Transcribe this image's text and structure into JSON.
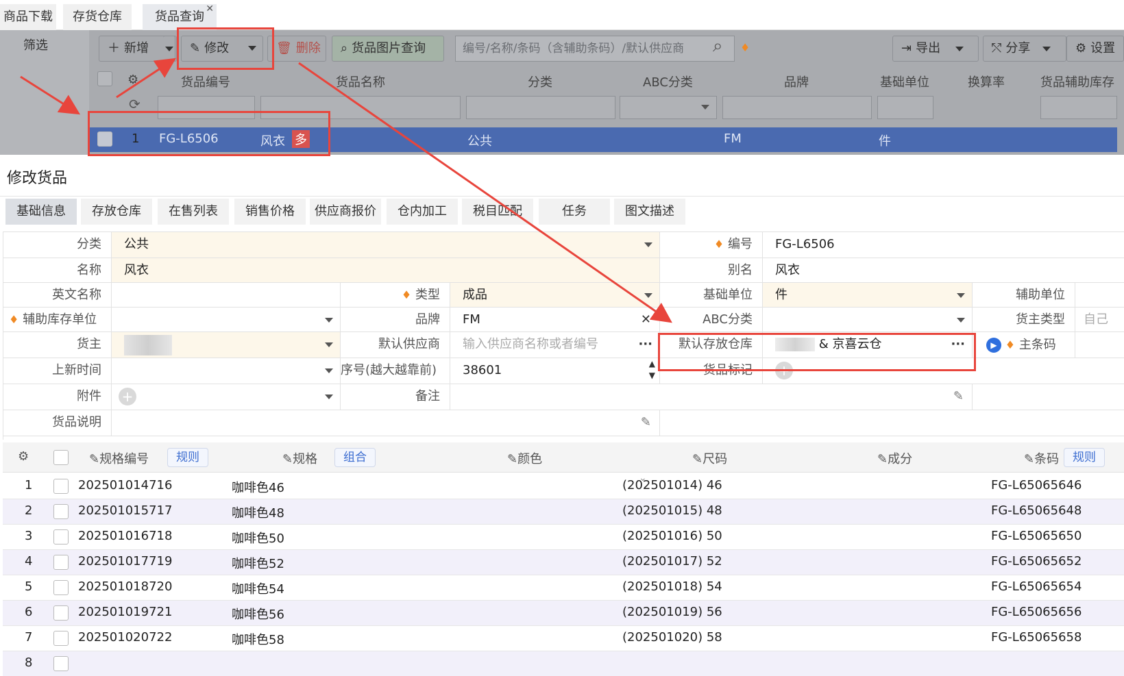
{
  "tabs": [
    {
      "label": "商品下载"
    },
    {
      "label": "存货仓库"
    },
    {
      "label": "货品查询"
    }
  ],
  "sidebar": {
    "filter": "筛选"
  },
  "toolbar": {
    "add": "新增",
    "edit": "修改",
    "delete": "删除",
    "image_query": "货品图片查询",
    "search_placeholder": "编号/名称/条码（含辅助条码）/默认供应商",
    "export": "导出",
    "share": "分享",
    "settings": "设置"
  },
  "grid": {
    "headers": [
      "货品编号",
      "货品名称",
      "分类",
      "ABC分类",
      "品牌",
      "基础单位",
      "换算率",
      "货品辅助库存"
    ],
    "row": {
      "index": "1",
      "code": "FG-L6506",
      "name": "风衣",
      "multi": "多",
      "category": "公共",
      "brand": "FM",
      "unit": "件"
    }
  },
  "form": {
    "title": "修改货品",
    "tabs": [
      "基础信息",
      "存放仓库",
      "在售列表",
      "销售价格",
      "供应商报价",
      "仓内加工",
      "税目匹配",
      "任务",
      "图文描述"
    ],
    "fields": {
      "category_label": "分类",
      "category": "公共",
      "code_label": "编号",
      "code": "FG-L6506",
      "name_label": "名称",
      "name": "风衣",
      "alias_label": "别名",
      "alias": "风衣",
      "en_name_label": "英文名称",
      "type_label": "类型",
      "type": "成品",
      "base_unit_label": "基础单位",
      "base_unit": "件",
      "aux_unit_label": "辅助单位",
      "aux_stock_unit_label": "辅助库存单位",
      "brand_label": "品牌",
      "brand": "FM",
      "abc_label": "ABC分类",
      "owner_type_label": "货主类型",
      "owner_type": "自己",
      "owner_label": "货主",
      "supplier_label": "默认供应商",
      "supplier_placeholder": "输入供应商名称或者编号",
      "warehouse_label": "默认存放仓库",
      "warehouse": "& 京喜云仓",
      "main_barcode_label": "主条码",
      "launch_label": "上新时间",
      "seq_label": "序号(越大越靠前)",
      "seq": "38601",
      "mark_label": "货品标记",
      "attach_label": "附件",
      "remark_label": "备注",
      "desc_label": "货品说明"
    }
  },
  "spec": {
    "headers": {
      "code": "规格编号",
      "rule": "规则",
      "spec": "规格",
      "combo": "组合",
      "color": "颜色",
      "size": "尺码",
      "comp": "成分",
      "barcode": "条码",
      "rule2": "规则"
    },
    "rows": [
      {
        "n": "1",
        "code": "202501014716",
        "spec": "咖啡色46",
        "size": "(202501014) 46",
        "barcode": "FG-L65065646"
      },
      {
        "n": "2",
        "code": "202501015717",
        "spec": "咖啡色48",
        "size": "(202501015) 48",
        "barcode": "FG-L65065648"
      },
      {
        "n": "3",
        "code": "202501016718",
        "spec": "咖啡色50",
        "size": "(202501016) 50",
        "barcode": "FG-L65065650"
      },
      {
        "n": "4",
        "code": "202501017719",
        "spec": "咖啡色52",
        "size": "(202501017) 52",
        "barcode": "FG-L65065652"
      },
      {
        "n": "5",
        "code": "202501018720",
        "spec": "咖啡色54",
        "size": "(202501018) 54",
        "barcode": "FG-L65065654"
      },
      {
        "n": "6",
        "code": "202501019721",
        "spec": "咖啡色56",
        "size": "(202501019) 56",
        "barcode": "FG-L65065656"
      },
      {
        "n": "7",
        "code": "202501020722",
        "spec": "咖啡色58",
        "size": "(202501020) 58",
        "barcode": "FG-L65065658"
      },
      {
        "n": "8",
        "code": "",
        "spec": "",
        "size": "",
        "barcode": ""
      }
    ]
  },
  "colors": {
    "accent": "#4a6ab0",
    "highlight": "#e8453c",
    "overlay": "#a9abaf"
  }
}
